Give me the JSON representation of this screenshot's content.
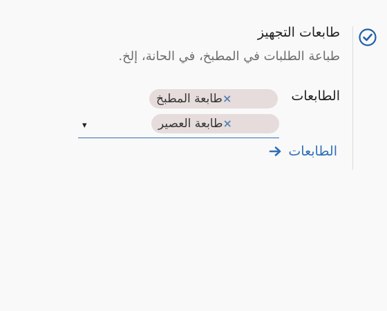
{
  "section": {
    "title": "طابعات التجهيز",
    "description": "طباعة الطلبات في المطبخ، في الحانة، إلخ.",
    "enabled": true
  },
  "printers_field": {
    "label": "الطابعات",
    "selected": [
      {
        "label": "طابعة المطبخ",
        "remove_glyph": "×"
      },
      {
        "label": "طابعة العصير",
        "remove_glyph": "×"
      }
    ],
    "dropdown_glyph": "▾"
  },
  "printers_link": {
    "label": "الطابعات",
    "icon": "arrow-right-icon"
  },
  "colors": {
    "accent": "#2f6fb7",
    "tag_bg": "#e6dcdc",
    "tag_remove": "#5b84b1"
  }
}
